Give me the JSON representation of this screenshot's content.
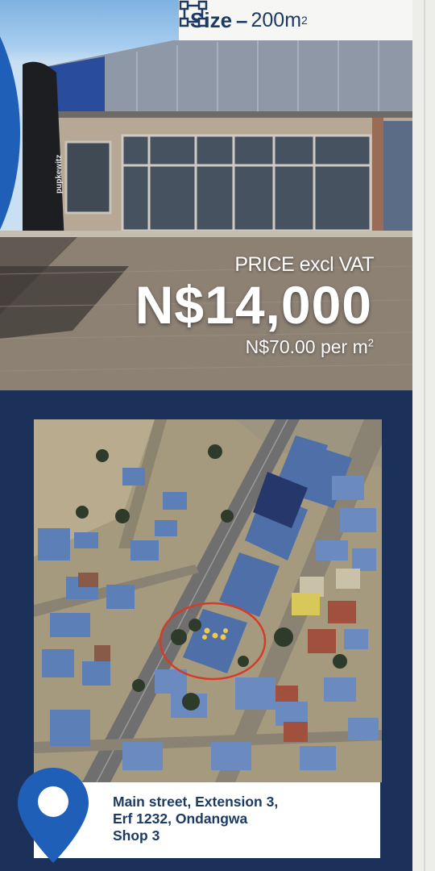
{
  "size_tab": {
    "icon": "resize-icon",
    "label": "Size",
    "dash": "–",
    "value": "200m",
    "unit_superscript": "2"
  },
  "price": {
    "caption": "PRICE excl VAT",
    "amount": "N$14,000",
    "per_unit": "N$70.00 per m",
    "per_unit_superscript": "2"
  },
  "photo": {
    "banner_text": "pupkewitz"
  },
  "address": {
    "line1": "Main street, Extension 3,",
    "line2": "Erf 1232, Ondangwa",
    "line3": "Shop 3",
    "icon": "location-pin-icon"
  },
  "colors": {
    "navy": "#1b3159",
    "text_navy": "#1d3a63",
    "pin_blue": "#1f5fb8",
    "marker_red": "#d83a2a"
  }
}
